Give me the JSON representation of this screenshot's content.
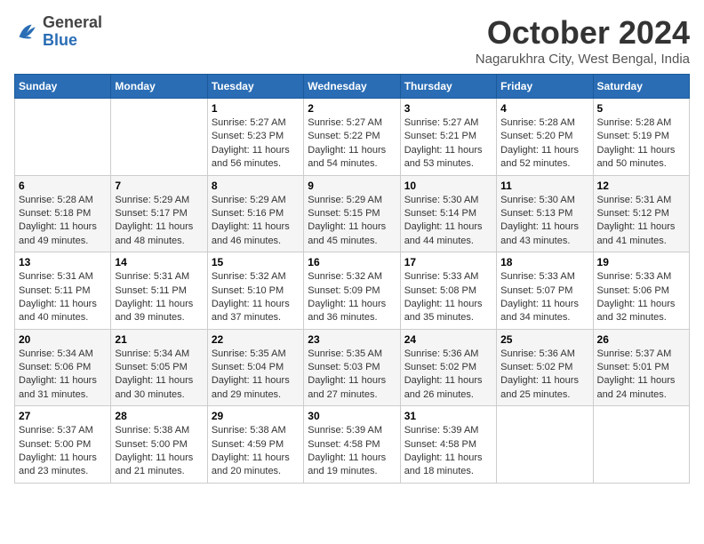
{
  "logo": {
    "general": "General",
    "blue": "Blue"
  },
  "title": "October 2024",
  "location": "Nagarukhra City, West Bengal, India",
  "days_header": [
    "Sunday",
    "Monday",
    "Tuesday",
    "Wednesday",
    "Thursday",
    "Friday",
    "Saturday"
  ],
  "weeks": [
    [
      {
        "day": "",
        "sunrise": "",
        "sunset": "",
        "daylight": ""
      },
      {
        "day": "",
        "sunrise": "",
        "sunset": "",
        "daylight": ""
      },
      {
        "day": "1",
        "sunrise": "Sunrise: 5:27 AM",
        "sunset": "Sunset: 5:23 PM",
        "daylight": "Daylight: 11 hours and 56 minutes."
      },
      {
        "day": "2",
        "sunrise": "Sunrise: 5:27 AM",
        "sunset": "Sunset: 5:22 PM",
        "daylight": "Daylight: 11 hours and 54 minutes."
      },
      {
        "day": "3",
        "sunrise": "Sunrise: 5:27 AM",
        "sunset": "Sunset: 5:21 PM",
        "daylight": "Daylight: 11 hours and 53 minutes."
      },
      {
        "day": "4",
        "sunrise": "Sunrise: 5:28 AM",
        "sunset": "Sunset: 5:20 PM",
        "daylight": "Daylight: 11 hours and 52 minutes."
      },
      {
        "day": "5",
        "sunrise": "Sunrise: 5:28 AM",
        "sunset": "Sunset: 5:19 PM",
        "daylight": "Daylight: 11 hours and 50 minutes."
      }
    ],
    [
      {
        "day": "6",
        "sunrise": "Sunrise: 5:28 AM",
        "sunset": "Sunset: 5:18 PM",
        "daylight": "Daylight: 11 hours and 49 minutes."
      },
      {
        "day": "7",
        "sunrise": "Sunrise: 5:29 AM",
        "sunset": "Sunset: 5:17 PM",
        "daylight": "Daylight: 11 hours and 48 minutes."
      },
      {
        "day": "8",
        "sunrise": "Sunrise: 5:29 AM",
        "sunset": "Sunset: 5:16 PM",
        "daylight": "Daylight: 11 hours and 46 minutes."
      },
      {
        "day": "9",
        "sunrise": "Sunrise: 5:29 AM",
        "sunset": "Sunset: 5:15 PM",
        "daylight": "Daylight: 11 hours and 45 minutes."
      },
      {
        "day": "10",
        "sunrise": "Sunrise: 5:30 AM",
        "sunset": "Sunset: 5:14 PM",
        "daylight": "Daylight: 11 hours and 44 minutes."
      },
      {
        "day": "11",
        "sunrise": "Sunrise: 5:30 AM",
        "sunset": "Sunset: 5:13 PM",
        "daylight": "Daylight: 11 hours and 43 minutes."
      },
      {
        "day": "12",
        "sunrise": "Sunrise: 5:31 AM",
        "sunset": "Sunset: 5:12 PM",
        "daylight": "Daylight: 11 hours and 41 minutes."
      }
    ],
    [
      {
        "day": "13",
        "sunrise": "Sunrise: 5:31 AM",
        "sunset": "Sunset: 5:11 PM",
        "daylight": "Daylight: 11 hours and 40 minutes."
      },
      {
        "day": "14",
        "sunrise": "Sunrise: 5:31 AM",
        "sunset": "Sunset: 5:11 PM",
        "daylight": "Daylight: 11 hours and 39 minutes."
      },
      {
        "day": "15",
        "sunrise": "Sunrise: 5:32 AM",
        "sunset": "Sunset: 5:10 PM",
        "daylight": "Daylight: 11 hours and 37 minutes."
      },
      {
        "day": "16",
        "sunrise": "Sunrise: 5:32 AM",
        "sunset": "Sunset: 5:09 PM",
        "daylight": "Daylight: 11 hours and 36 minutes."
      },
      {
        "day": "17",
        "sunrise": "Sunrise: 5:33 AM",
        "sunset": "Sunset: 5:08 PM",
        "daylight": "Daylight: 11 hours and 35 minutes."
      },
      {
        "day": "18",
        "sunrise": "Sunrise: 5:33 AM",
        "sunset": "Sunset: 5:07 PM",
        "daylight": "Daylight: 11 hours and 34 minutes."
      },
      {
        "day": "19",
        "sunrise": "Sunrise: 5:33 AM",
        "sunset": "Sunset: 5:06 PM",
        "daylight": "Daylight: 11 hours and 32 minutes."
      }
    ],
    [
      {
        "day": "20",
        "sunrise": "Sunrise: 5:34 AM",
        "sunset": "Sunset: 5:06 PM",
        "daylight": "Daylight: 11 hours and 31 minutes."
      },
      {
        "day": "21",
        "sunrise": "Sunrise: 5:34 AM",
        "sunset": "Sunset: 5:05 PM",
        "daylight": "Daylight: 11 hours and 30 minutes."
      },
      {
        "day": "22",
        "sunrise": "Sunrise: 5:35 AM",
        "sunset": "Sunset: 5:04 PM",
        "daylight": "Daylight: 11 hours and 29 minutes."
      },
      {
        "day": "23",
        "sunrise": "Sunrise: 5:35 AM",
        "sunset": "Sunset: 5:03 PM",
        "daylight": "Daylight: 11 hours and 27 minutes."
      },
      {
        "day": "24",
        "sunrise": "Sunrise: 5:36 AM",
        "sunset": "Sunset: 5:02 PM",
        "daylight": "Daylight: 11 hours and 26 minutes."
      },
      {
        "day": "25",
        "sunrise": "Sunrise: 5:36 AM",
        "sunset": "Sunset: 5:02 PM",
        "daylight": "Daylight: 11 hours and 25 minutes."
      },
      {
        "day": "26",
        "sunrise": "Sunrise: 5:37 AM",
        "sunset": "Sunset: 5:01 PM",
        "daylight": "Daylight: 11 hours and 24 minutes."
      }
    ],
    [
      {
        "day": "27",
        "sunrise": "Sunrise: 5:37 AM",
        "sunset": "Sunset: 5:00 PM",
        "daylight": "Daylight: 11 hours and 23 minutes."
      },
      {
        "day": "28",
        "sunrise": "Sunrise: 5:38 AM",
        "sunset": "Sunset: 5:00 PM",
        "daylight": "Daylight: 11 hours and 21 minutes."
      },
      {
        "day": "29",
        "sunrise": "Sunrise: 5:38 AM",
        "sunset": "Sunset: 4:59 PM",
        "daylight": "Daylight: 11 hours and 20 minutes."
      },
      {
        "day": "30",
        "sunrise": "Sunrise: 5:39 AM",
        "sunset": "Sunset: 4:58 PM",
        "daylight": "Daylight: 11 hours and 19 minutes."
      },
      {
        "day": "31",
        "sunrise": "Sunrise: 5:39 AM",
        "sunset": "Sunset: 4:58 PM",
        "daylight": "Daylight: 11 hours and 18 minutes."
      },
      {
        "day": "",
        "sunrise": "",
        "sunset": "",
        "daylight": ""
      },
      {
        "day": "",
        "sunrise": "",
        "sunset": "",
        "daylight": ""
      }
    ]
  ]
}
